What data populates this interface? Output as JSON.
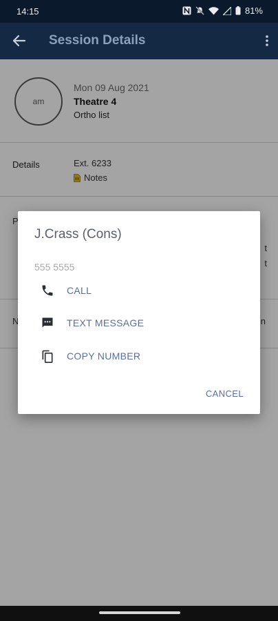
{
  "status_bar": {
    "time": "14:15",
    "battery": "81%"
  },
  "app_bar": {
    "title": "Session Details"
  },
  "session": {
    "avatar_initials": "am",
    "date": "Mon 09 Aug 2021",
    "theatre": "Theatre 4",
    "list_name": "Ortho list"
  },
  "details": {
    "label": "Details",
    "extension": "Ext. 6233",
    "notes": "Notes"
  },
  "background_fragments": {
    "left_p": "P",
    "left_n": "N",
    "right_t1": "t",
    "right_t2": "t",
    "right_n": "n"
  },
  "dialog": {
    "title": "J.Crass (Cons)",
    "phone": "555 5555",
    "actions": [
      {
        "label": "CALL",
        "icon": "phone-icon"
      },
      {
        "label": "TEXT MESSAGE",
        "icon": "message-icon"
      },
      {
        "label": "COPY NUMBER",
        "icon": "copy-icon"
      }
    ],
    "cancel_label": "CANCEL"
  },
  "colors": {
    "status_bar": "#0a1a2c",
    "app_bar": "#142a44",
    "accent_text": "#5a6e9a"
  }
}
